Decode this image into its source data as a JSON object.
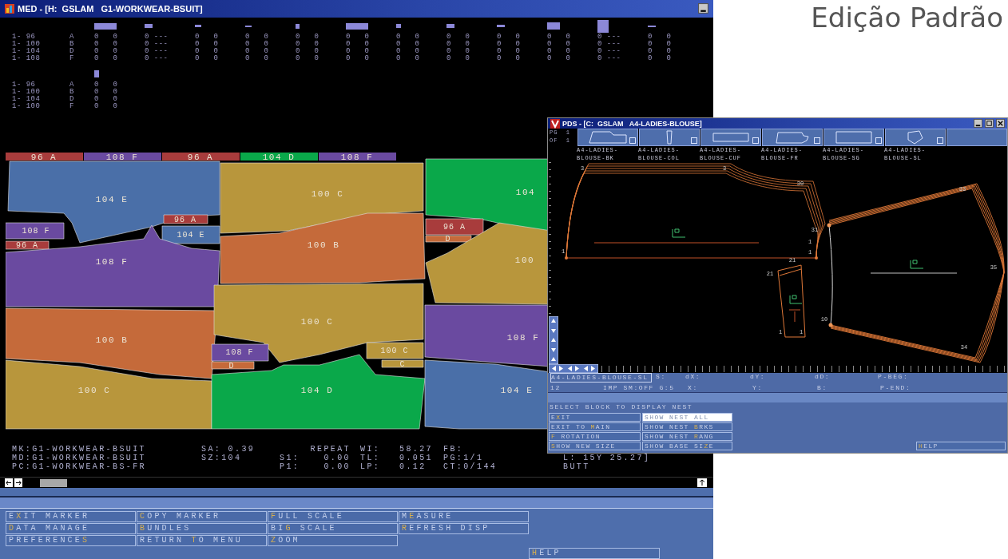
{
  "header": {
    "text": "Edição Padrão"
  },
  "marker_window": {
    "title": "MED - [H:  GSLAM   G1-WORKWEAR-BSUIT]",
    "size_tables": [
      {
        "rows": [
          {
            "size": "1- 96",
            "code": "A",
            "cells": [
              "0   0",
              "0 ---",
              "0   0",
              "0   0",
              "0   0",
              "0   0",
              "0   0",
              "0   0",
              "0   0",
              "0   0",
              "0 ---",
              "0   0"
            ]
          },
          {
            "size": "1- 100",
            "code": "B",
            "cells": [
              "0   0",
              "0 ---",
              "0   0",
              "0   0",
              "0   0",
              "0   0",
              "0   0",
              "0   0",
              "0   0",
              "0   0",
              "0 ---",
              "0   0"
            ]
          },
          {
            "size": "1- 104",
            "code": "D",
            "cells": [
              "0   0",
              "0 ---",
              "0   0",
              "0   0",
              "0   0",
              "0   0",
              "0   0",
              "0   0",
              "0   0",
              "0   0",
              "0 ---",
              "0   0"
            ]
          },
          {
            "size": "1- 108",
            "code": "F",
            "cells": [
              "0   0",
              "0 ---",
              "0   0",
              "0   0",
              "0   0",
              "0   0",
              "0   0",
              "0   0",
              "0   0",
              "0   0",
              "0 ---",
              "0   0"
            ]
          }
        ]
      },
      {
        "rows": [
          {
            "size": "1- 96",
            "code": "A",
            "cells": [
              "0   0"
            ]
          },
          {
            "size": "1- 100",
            "code": "B",
            "cells": [
              "0   0"
            ]
          },
          {
            "size": "1- 104",
            "code": "D",
            "cells": [
              "0   0"
            ]
          },
          {
            "size": "1- 100",
            "code": "F",
            "cells": [
              "0   0"
            ]
          }
        ]
      }
    ],
    "size_bars": [
      {
        "label": "96 A",
        "color": "#a83c3c"
      },
      {
        "label": "108 F",
        "color": "#6a4aa0"
      },
      {
        "label": "96 A",
        "color": "#a83c3c"
      },
      {
        "label": "104 D",
        "color": "#0aa84a"
      },
      {
        "label": "108 F",
        "color": "#6a4aa0"
      }
    ],
    "pieces": [
      {
        "label": "104 E",
        "color": "#4a6fa8"
      },
      {
        "label": "108 F",
        "color": "#6a4aa0"
      },
      {
        "label": "96 A",
        "color": "#a83c3c"
      },
      {
        "label": "96 A",
        "color": "#a83c3c"
      },
      {
        "label": "104 E",
        "color": "#4a6fa8"
      },
      {
        "label": "108 F",
        "color": "#6a4aa0"
      },
      {
        "label": "100 B",
        "color": "#c56a3a"
      },
      {
        "label": "100 C",
        "color": "#b8963c"
      },
      {
        "label": "100 C",
        "color": "#b8963c"
      },
      {
        "label": "100 B",
        "color": "#c56a3a"
      },
      {
        "label": "100 C",
        "color": "#b8963c"
      },
      {
        "label": "108 F",
        "color": "#6a4aa0"
      },
      {
        "label": "D",
        "color": "#c56a3a"
      },
      {
        "label": "100 C",
        "color": "#b8963c"
      },
      {
        "label": "C",
        "color": "#b8963c"
      },
      {
        "label": "104 D",
        "color": "#0aa84a"
      },
      {
        "label": "104",
        "color": "#0aa84a"
      },
      {
        "label": "96 A",
        "color": "#a83c3c"
      },
      {
        "label": "D",
        "color": "#c56a3a"
      },
      {
        "label": "100",
        "color": "#b8963c"
      },
      {
        "label": "108 F",
        "color": "#6a4aa0"
      },
      {
        "label": "104 E",
        "color": "#4a6fa8"
      }
    ],
    "info_rows": [
      {
        "name": "MK:G1-WORKWEAR-BSUIT",
        "setting": "SA: 0.39",
        "offset_value": "REPEAT",
        "measure_label": "WI:",
        "measure_value": "58.27",
        "status": "FB:"
      },
      {
        "name": "MD:G1-WORKWEAR-BSUIT",
        "setting": "SZ:104",
        "offset_label": "S1:",
        "offset_value": "0.00",
        "measure_label": "TL:",
        "measure_value": "0.051",
        "status": "PG:1/1",
        "extra": "L: 15Y 25.27]"
      },
      {
        "name": "PC:G1-WORKWEAR-BS-FR",
        "offset_label": "P1:",
        "offset_value": "0.00",
        "measure_label": "LP:",
        "measure_value": "0.12",
        "status": "CT:0/144",
        "extra": "BUTT"
      }
    ],
    "menu_buttons": [
      {
        "pre": "E",
        "key": "X",
        "post": "IT MARKER"
      },
      {
        "key": "C",
        "post": "OPY MARKER"
      },
      {
        "key": "F",
        "post": "ULL SCALE"
      },
      {
        "pre": "M",
        "key": "E",
        "post": "ASURE"
      },
      {
        "key": "D",
        "post": "ATA MANAGE"
      },
      {
        "key": "B",
        "post": "UNDLES"
      },
      {
        "pre": "BI",
        "key": "G",
        "post": " SCALE"
      },
      {
        "key": "R",
        "post": "EFRESH DISP"
      },
      {
        "pre": "PREFERENCE",
        "key": "S"
      },
      {
        "pre": "RETURN ",
        "key": "T",
        "post": "O MENU"
      },
      {
        "key": "Z",
        "post": "OOM"
      }
    ],
    "help_button": {
      "key": "H",
      "post": "ELP"
    }
  },
  "pattern_window": {
    "title": "PDS - [C:  GSLAM   A4-LADIES-BLOUSE]",
    "pager": [
      "PG  1",
      "OF  1"
    ],
    "blocks": [
      {
        "name_lines": [
          "A4-LADIES-",
          "BLOUSE-BK"
        ]
      },
      {
        "name_lines": [
          "A4-LADIES-",
          "BLOUSE-COL"
        ]
      },
      {
        "name_lines": [
          "A4-LADIES-",
          "BLOUSE-CUF"
        ]
      },
      {
        "name_lines": [
          "A4-LADIES-",
          "BLOUSE-FR"
        ]
      },
      {
        "name_lines": [
          "A4-LADIES-",
          "BLOUSE-SG"
        ]
      },
      {
        "name_lines": [
          "A4-LADIES-",
          "BLOUSE-SL"
        ]
      }
    ],
    "point_labels": [
      "3",
      "3",
      "30",
      "31",
      "1",
      "1",
      "1",
      "21",
      "21",
      "1",
      "1",
      "33",
      "35",
      "10",
      "34"
    ],
    "status": {
      "piece": "A4-LADIES-BLOUSE-SL",
      "row1": [
        "S:",
        "dX:",
        "dY:",
        "dD:",
        "P-BEG:"
      ],
      "number": "12",
      "mode": "IMP SM:OFF G:5",
      "row2": [
        "X:",
        "Y:",
        "B:",
        "P-END:"
      ]
    },
    "prompt": "SELECT BLOCK TO DISPLAY NEST",
    "buttons": [
      {
        "pre": "E",
        "key": "X",
        "post": "IT",
        "selected": false
      },
      {
        "pre": "SHOW NEST ALL",
        "selected": true
      },
      {
        "pre": "EXIT TO ",
        "key": "M",
        "post": "AIN",
        "selected": false
      },
      {
        "pre": "SHOW NEST ",
        "key": "B",
        "post": "RKS",
        "selected": false
      },
      {
        "key": "F",
        "post": " ROTATION",
        "selected": false
      },
      {
        "pre": "SHOW NEST ",
        "key": "R",
        "post": "ANG",
        "selected": false
      },
      {
        "key": "S",
        "post": "HOW NEW SIZE",
        "selected": false
      },
      {
        "pre": "SHOW BASE SI",
        "key": "Z",
        "post": "E",
        "selected": false
      }
    ],
    "help_button": {
      "key": "H",
      "post": "ELP"
    }
  }
}
